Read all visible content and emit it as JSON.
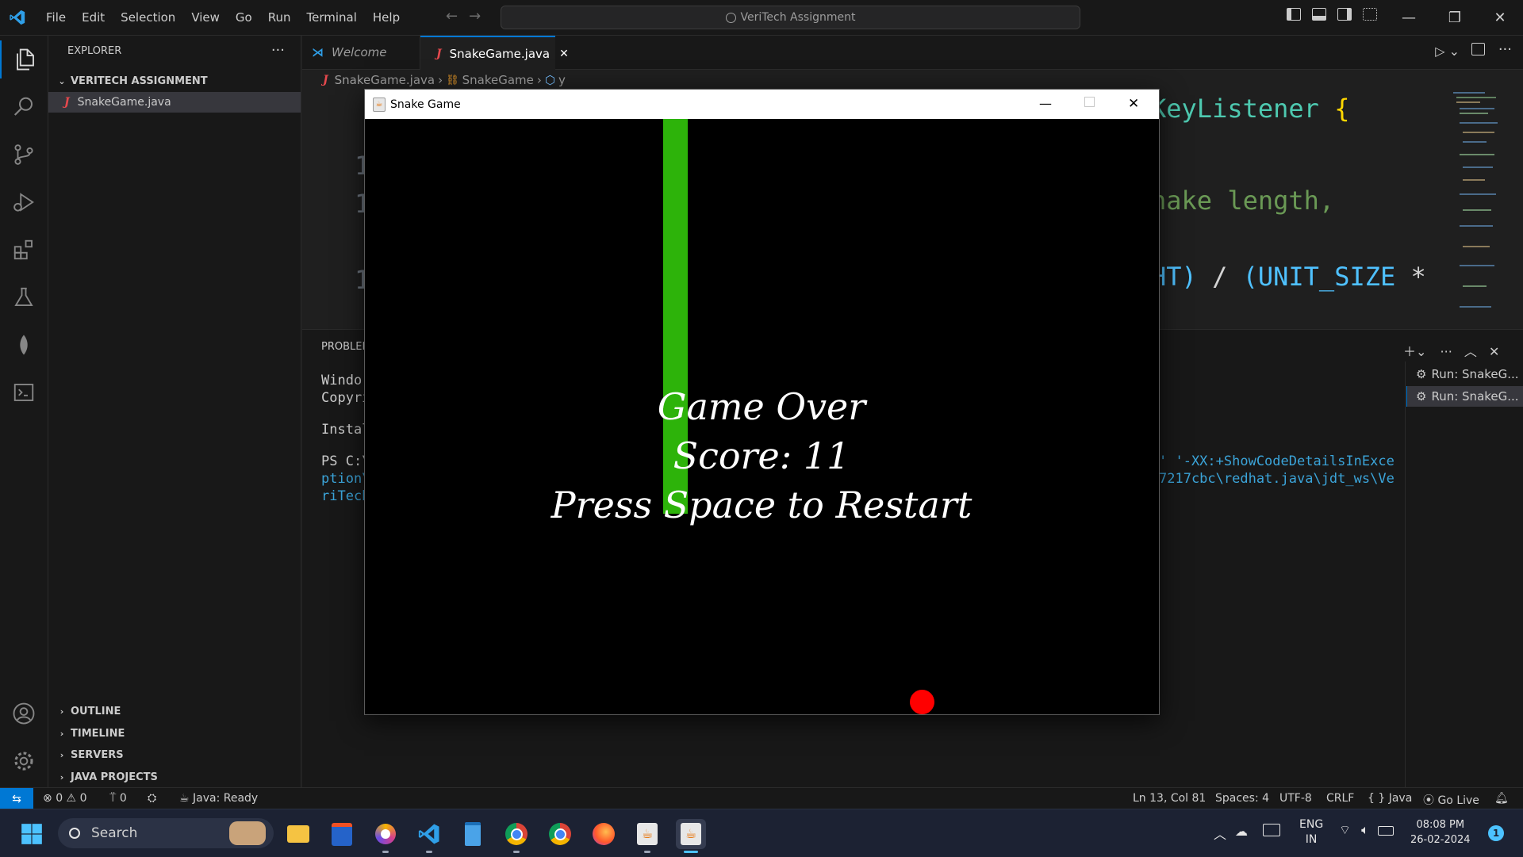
{
  "titlebar": {
    "menu": [
      "File",
      "Edit",
      "Selection",
      "View",
      "Go",
      "Run",
      "Terminal",
      "Help"
    ],
    "command_center": "VeriTech Assignment"
  },
  "sidebar": {
    "header": "EXPLORER",
    "project": "VERITECH ASSIGNMENT",
    "file": "SnakeGame.java",
    "sections": [
      "OUTLINE",
      "TIMELINE",
      "SERVERS",
      "JAVA PROJECTS"
    ]
  },
  "tabs": [
    {
      "label": "Welcome",
      "active": false
    },
    {
      "label": "SnakeGame.java",
      "active": true
    }
  ],
  "breadcrumb": [
    "SnakeGame.java",
    "SnakeGame",
    "y"
  ],
  "editor": {
    "line_numbers": [
      "1",
      "1",
      "1"
    ],
    "visible_code": {
      "line1_a": "KeyListener",
      "line1_b": "{",
      "line2": "nake length,",
      "line3_a": "HT)",
      "line3_b": "/",
      "line3_c": "(UNIT_SIZE",
      "line3_d": "*"
    }
  },
  "panel": {
    "tab_fragment": "PROBLEN",
    "left_lines": [
      "Windo",
      "Copyri",
      "Instal",
      "PS C:\\",
      "ption\\",
      "riTech"
    ],
    "right_line1": "' '-XX:+ShowCodeDetailsInExce",
    "right_line2": "7217cbc\\redhat.java\\jdt_ws\\Ve",
    "run_items": [
      "Run: SnakeG...",
      "Run: SnakeG..."
    ]
  },
  "game": {
    "window_title": "Snake Game",
    "game_over": "Game Over",
    "score_label": "Score: 11",
    "restart": "Press Space to Restart",
    "snake_color": "#2db30a",
    "apple_color": "#ff0000"
  },
  "statusbar": {
    "errors": "0",
    "warnings": "0",
    "ports": "0",
    "java_status": "Java: Ready",
    "position": "Ln 13, Col 81",
    "spaces": "Spaces: 4",
    "encoding": "UTF-8",
    "eol": "CRLF",
    "language": "Java",
    "golive": "Go Live"
  },
  "taskbar": {
    "search": "Search",
    "language": "ENG",
    "region": "IN",
    "time": "08:08 PM",
    "date": "26-02-2024",
    "notification_count": "1"
  },
  "colors": {
    "accent": "#0078d4",
    "background": "#1f1f1f"
  }
}
